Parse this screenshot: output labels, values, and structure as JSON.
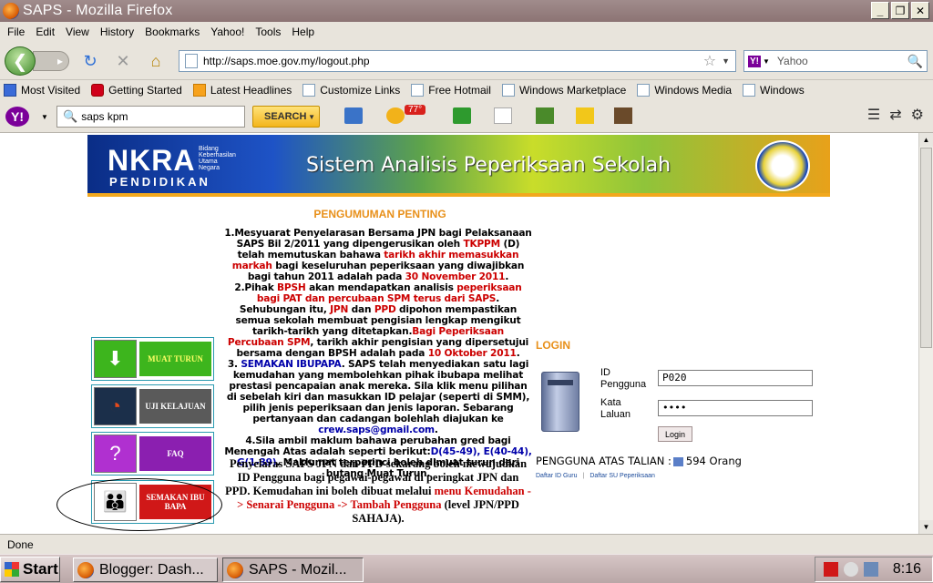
{
  "window": {
    "title": "SAPS - Mozilla Firefox"
  },
  "menu": [
    "File",
    "Edit",
    "View",
    "History",
    "Bookmarks",
    "Yahoo!",
    "Tools",
    "Help"
  ],
  "nav": {
    "url": "http://saps.moe.gov.my/logout.php",
    "search_placeholder": "Yahoo"
  },
  "bookmarks": [
    "Most Visited",
    "Getting Started",
    "Latest Headlines",
    "Customize Links",
    "Free Hotmail",
    "Windows Marketplace",
    "Windows Media",
    "Windows"
  ],
  "yahoo_toolbar": {
    "search_value": "saps kpm",
    "search_button": "SEARCH",
    "weather": "77°"
  },
  "banner": {
    "logo": "NKRA",
    "logo_sub": "PENDIDIKAN",
    "logo_small": "Bidang Keberhasilan Utama Negara",
    "title": "Sistem Analisis Peperiksaan Sekolah"
  },
  "announcement": {
    "heading": "PENGUMUMAN PENTING",
    "p1": [
      "1.Mesyuarat Penyelarasan Bersama JPN bagi Pelaksanaan SAPS Bil 2/2011 yang dipengerusikan oleh ",
      "TKPPM",
      " (D) telah memutuskan bahawa ",
      "tarikh akhir memasukkan markah",
      " bagi keseluruhan peperiksaan yang diwajibkan bagi tahun 2011 adalah pada ",
      "30 November 2011",
      "."
    ],
    "p2": [
      "2.Pihak ",
      "BPSH",
      " akan mendapatkan analisis ",
      "peperiksaan bagi PAT dan percubaan SPM terus dari SAPS",
      ". Sehubungan itu, ",
      "JPN",
      " dan ",
      "PPD",
      " dipohon mempastikan semua sekolah membuat pengisian lengkap mengikut tarikh-tarikh yang ditetapkan.",
      "Bagi Peperiksaan Percubaan SPM",
      ", tarikh akhir pengisian yang dipersetujui bersama dengan BPSH adalah pada ",
      "10 Oktober 2011",
      "."
    ],
    "p3": [
      "3. ",
      "SEMAKAN IBUPAPA",
      ". SAPS telah menyediakan satu lagi kemudahan yang membolehkan pihak ibubapa melihat prestasi pencapaian anak mereka. Sila klik menu pilihan di sebelah kiri dan masukkan ID pelajar (seperti di SMM), pilih jenis peperiksaan dan jenis laporan. Sebarang pertanyaan dan cadangan bolehlah diajukan ke ",
      "crew.saps@gmail.com",
      "."
    ],
    "p4": [
      "4.Sila ambil maklum bahawa perubahan gred bagi Menengah Atas adalah seperti berikut:",
      "D(45-49), E(40-44), G(1-39)",
      ". Maklumat terperinci boleh dimuat turun dari butang Muat Turun."
    ],
    "p5": [
      "Penyelaras SAPS JPN dan PPD sekarang boleh mewujudkan ID Pengguna bagi pegawai-pegawai di peringkat JPN dan PPD. Kemudahan ini boleh dibuat melalui ",
      "menu Kemudahan -> Senarai Pengguna -> Tambah Pengguna",
      " (level JPN/PPD SAHAJA)."
    ]
  },
  "left_menu": [
    {
      "label": "MUAT TURUN",
      "bg": "#3db51d",
      "icon_bg": "#3db51d"
    },
    {
      "label": "UJI KELAJUAN",
      "bg": "#5a5a5a",
      "icon_bg": "#1b2f4a"
    },
    {
      "label": "FAQ",
      "bg": "#8b1fb0",
      "icon_bg": "#b030d0"
    },
    {
      "label": "SEMAKAN IBU BAPA",
      "bg": "#d01818",
      "icon_bg": "#ffffff"
    }
  ],
  "login": {
    "heading": "LOGIN",
    "id_label": "ID Pengguna",
    "id_value": "P020",
    "pw_label": "Kata Laluan",
    "pw_value": "••••",
    "button": "Login",
    "online_label": "PENGGUNA ATAS TALIAN :",
    "online_count": "594 Orang",
    "link1": "Daftar ID Guru",
    "link2": "Daftar SU Peperiksaan"
  },
  "status": "Done",
  "taskbar": {
    "start": "Start",
    "tasks": [
      "Blogger: Dash...",
      "SAPS - Mozil..."
    ],
    "time": "8:16"
  }
}
